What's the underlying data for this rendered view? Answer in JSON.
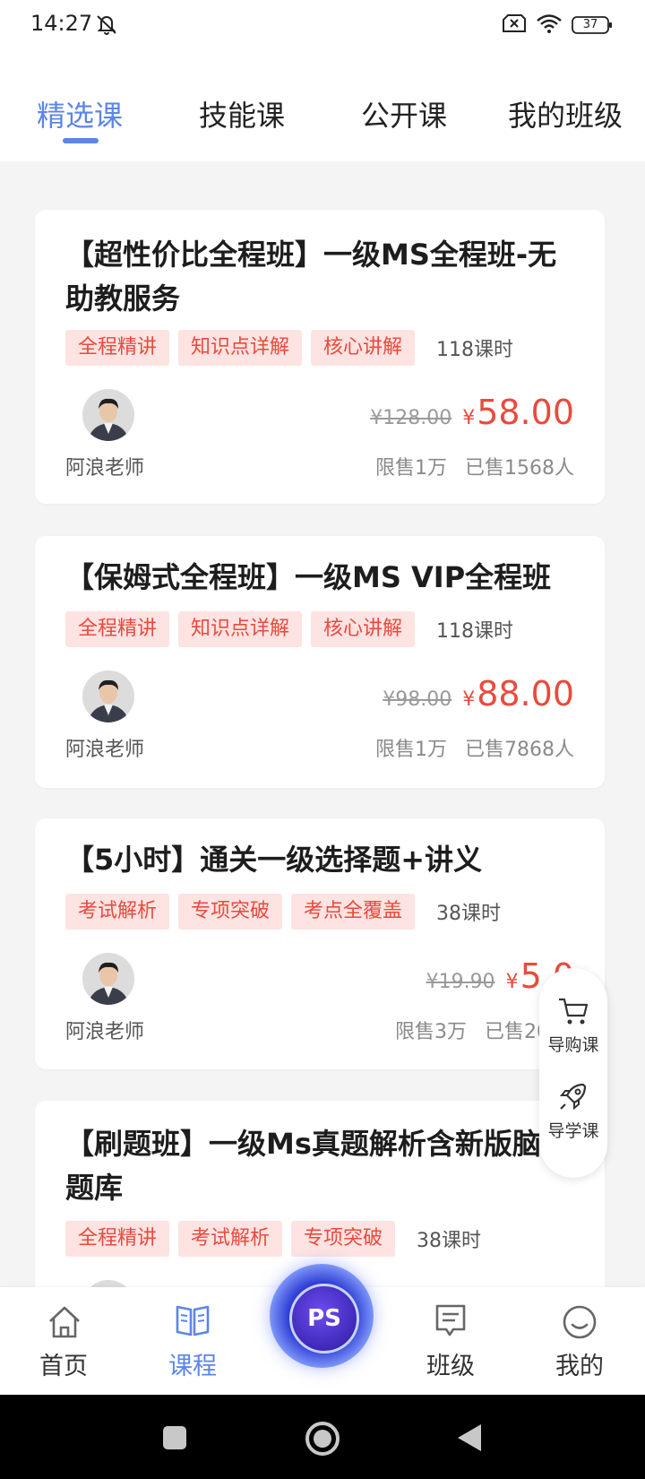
{
  "status": {
    "time": "14:27",
    "battery": "37"
  },
  "tabs": [
    {
      "label": "精选课",
      "active": true
    },
    {
      "label": "技能课"
    },
    {
      "label": "公开课"
    },
    {
      "label": "我的班级"
    }
  ],
  "courses": [
    {
      "title": "【超性价比全程班】一级MS全程班-无助教服务",
      "tags": [
        "全程精讲",
        "知识点详解",
        "核心讲解"
      ],
      "hours": "118课时",
      "teacher": "阿浪老师",
      "orig_price": "¥128.00",
      "currency": "¥",
      "price": "58.00",
      "limit": "限售1万",
      "sold": "已售1568人"
    },
    {
      "title": "【保姆式全程班】一级MS VIP全程班",
      "tags": [
        "全程精讲",
        "知识点详解",
        "核心讲解"
      ],
      "hours": "118课时",
      "teacher": "阿浪老师",
      "orig_price": "¥98.00",
      "currency": "¥",
      "price": "88.00",
      "limit": "限售1万",
      "sold": "已售7868人"
    },
    {
      "title": "【5小时】通关一级选择题+讲义",
      "tags": [
        "考试解析",
        "专项突破",
        "考点全覆盖"
      ],
      "hours": "38课时",
      "teacher": "阿浪老师",
      "orig_price": "¥19.90",
      "currency": "¥",
      "price": "5.0",
      "limit": "限售3万",
      "sold": "已售2054"
    },
    {
      "title": "【刷题班】一级Ms真题解析含新版脑题库",
      "tags": [
        "全程精讲",
        "考试解析",
        "专项突破"
      ],
      "hours": "38课时"
    }
  ],
  "float_panel": {
    "guide_buy": "导购课",
    "guide_study": "导学课"
  },
  "bottom_nav": [
    {
      "label": "首页",
      "icon": "home-icon"
    },
    {
      "label": "课程",
      "icon": "book-icon",
      "active": true
    },
    {
      "label": "PS",
      "icon": "ps-logo"
    },
    {
      "label": "班级",
      "icon": "class-icon"
    },
    {
      "label": "我的",
      "icon": "smile-icon"
    }
  ],
  "colors": {
    "accent": "#5b86e5",
    "price": "#e94a3e",
    "tag_bg": "#fde3e1"
  }
}
